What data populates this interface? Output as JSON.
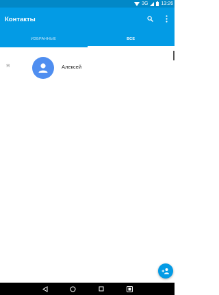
{
  "status_bar": {
    "network": "3G",
    "time": "13:26",
    "icons": [
      "wifi-icon",
      "signal-icon",
      "battery-icon"
    ]
  },
  "app_bar": {
    "title": "Контакты",
    "icons": [
      "search-icon",
      "more-vert-icon"
    ]
  },
  "tabs": [
    {
      "label": "ИЗБРАННЫЕ",
      "active": false
    },
    {
      "label": "ВСЕ",
      "active": true
    }
  ],
  "contacts": [
    {
      "section_letter": "Я",
      "name": "Алексей",
      "avatar_icon": "person-icon"
    }
  ],
  "fab": {
    "icon": "add-contact-icon"
  },
  "nav_bar": {
    "icons": [
      "back-icon",
      "home-icon",
      "recents-icon",
      "screenshot-icon"
    ]
  },
  "colors": {
    "status_bar": "#0288c7",
    "app_bar": "#039be5",
    "avatar": "#4f8ef0",
    "fab": "#039be5"
  }
}
